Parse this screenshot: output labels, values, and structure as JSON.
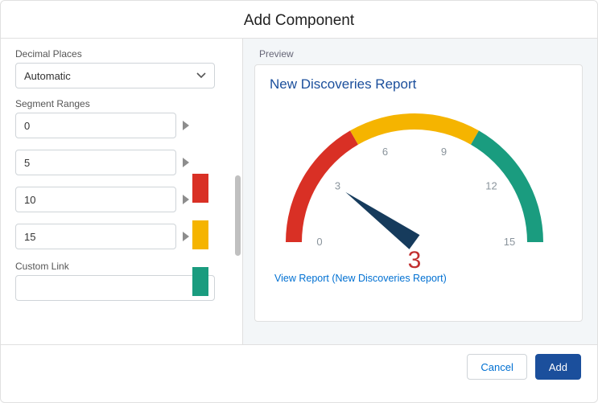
{
  "modal": {
    "title": "Add Component"
  },
  "left": {
    "decimal_label": "Decimal Places",
    "decimal_value": "Automatic",
    "segments_label": "Segment Ranges",
    "segments": [
      {
        "value": "0",
        "color": "#d93025"
      },
      {
        "value": "5",
        "color": "#f5b400"
      },
      {
        "value": "10",
        "color": "#1a9c7f"
      },
      {
        "value": "15",
        "color": null
      }
    ],
    "custom_link_label": "Custom Link",
    "custom_link_value": ""
  },
  "preview": {
    "label": "Preview",
    "chart_title": "New Discoveries Report",
    "view_report": "View Report (New Discoveries Report)"
  },
  "footer": {
    "cancel": "Cancel",
    "add": "Add"
  },
  "chart_data": {
    "type": "gauge",
    "min": 0,
    "max": 15,
    "value": 3,
    "ticks": [
      0,
      3,
      6,
      9,
      12,
      15
    ],
    "bands": [
      {
        "from": 0,
        "to": 5,
        "color": "#d93025"
      },
      {
        "from": 5,
        "to": 10,
        "color": "#f5b400"
      },
      {
        "from": 10,
        "to": 15,
        "color": "#1a9c7f"
      }
    ],
    "title": "New Discoveries Report"
  }
}
